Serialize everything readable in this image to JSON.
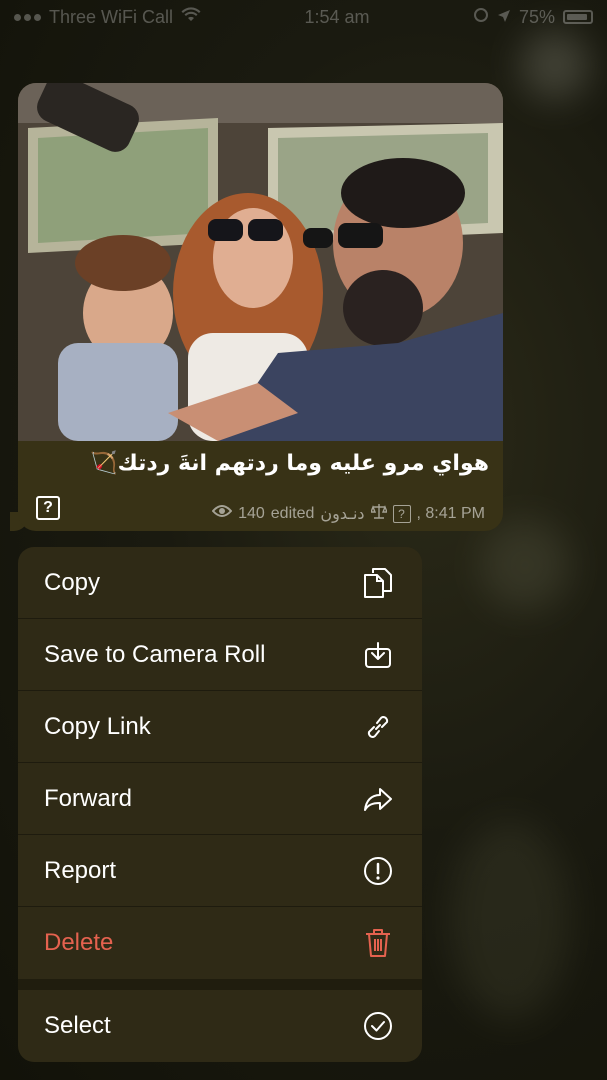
{
  "status_bar": {
    "carrier": "Three WiFi Call",
    "time": "1:54 am",
    "battery": "75%"
  },
  "message": {
    "caption": "هواي مرو عليه وما ردتهم انةَ ردتك🏹",
    "help_badge": "?",
    "views": "140",
    "edited": "edited",
    "author": "دنـدون",
    "time": ", 8:41 PM"
  },
  "menu": {
    "items": [
      {
        "label": "Copy",
        "icon": "copy-icon"
      },
      {
        "label": "Save to Camera Roll",
        "icon": "download-icon"
      },
      {
        "label": "Copy Link",
        "icon": "link-icon"
      },
      {
        "label": "Forward",
        "icon": "forward-icon"
      },
      {
        "label": "Report",
        "icon": "alert-icon"
      },
      {
        "label": "Delete",
        "icon": "trash-icon"
      }
    ],
    "select": {
      "label": "Select",
      "icon": "check-circle-icon"
    }
  },
  "colors": {
    "bubble": "#383216",
    "menu": "#2f2a16",
    "destructive": "#e5624f"
  }
}
